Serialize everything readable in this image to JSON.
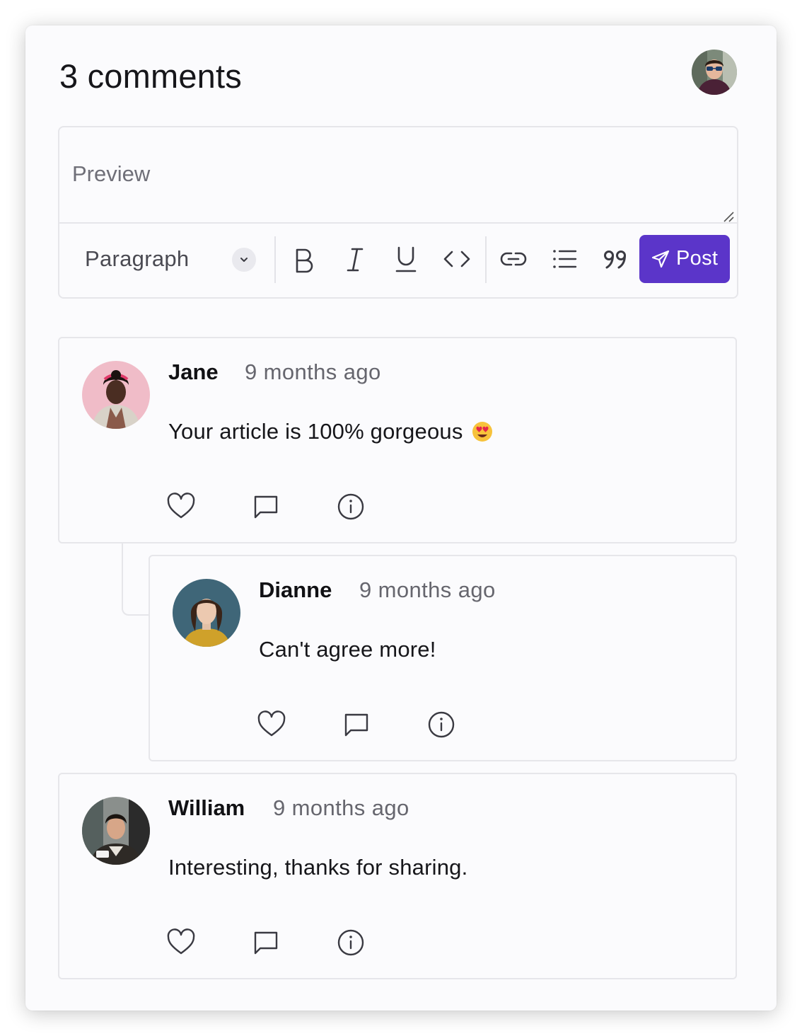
{
  "header": {
    "title": "3 comments",
    "current_user_avatar": "user-avatar"
  },
  "editor": {
    "placeholder": "Preview",
    "value": "",
    "format_select": {
      "selected": "Paragraph"
    },
    "tools": [
      {
        "name": "bold",
        "icon": "bold-icon"
      },
      {
        "name": "italic",
        "icon": "italic-icon"
      },
      {
        "name": "underline",
        "icon": "underline-icon"
      },
      {
        "name": "code",
        "icon": "code-icon"
      },
      {
        "name": "link",
        "icon": "link-icon"
      },
      {
        "name": "bullet-list",
        "icon": "list-icon"
      },
      {
        "name": "quote",
        "icon": "quote-icon"
      }
    ],
    "post_label": "Post"
  },
  "comments": [
    {
      "author": "Jane",
      "time": "9 months ago",
      "text": "Your article is 100% gorgeous",
      "emoji": "heart-eyes-emoji",
      "avatar": "jane-avatar",
      "is_reply": false
    },
    {
      "author": "Dianne",
      "time": "9 months ago",
      "text": "Can't agree more!",
      "avatar": "dianne-avatar",
      "is_reply": true
    },
    {
      "author": "William",
      "time": "9 months ago",
      "text": "Interesting, thanks for sharing.",
      "avatar": "william-avatar",
      "is_reply": false
    }
  ],
  "actions": [
    "heart-icon",
    "comment-icon",
    "info-icon"
  ],
  "colors": {
    "accent": "#5b35c9",
    "border": "#e6e6ea",
    "panel_bg": "#fbfbfd",
    "muted_text": "#66666e"
  }
}
